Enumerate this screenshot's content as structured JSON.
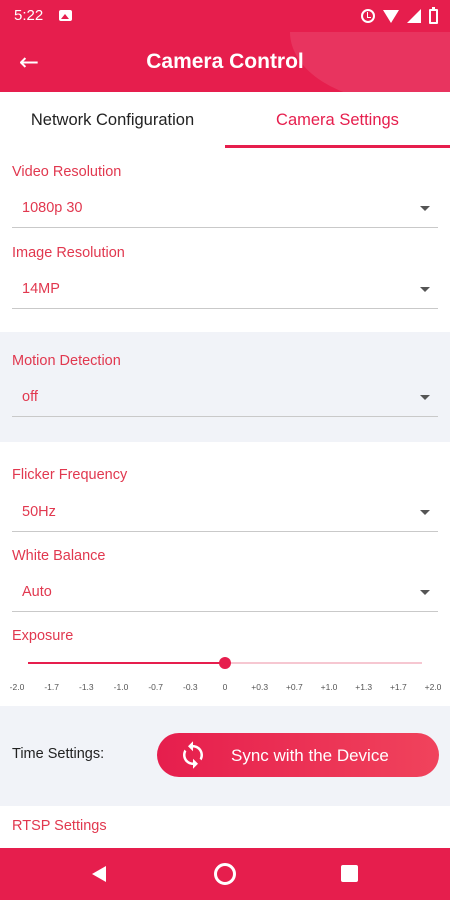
{
  "status_bar": {
    "time": "5:22",
    "icons": [
      "image-icon",
      "alarm-icon",
      "wifi-icon",
      "signal-icon",
      "battery-icon"
    ]
  },
  "app_bar": {
    "title": "Camera Control",
    "back_icon": "arrow-back-icon",
    "color": "#e61e4d"
  },
  "tabs": [
    {
      "label": "Network Configuration",
      "active": false
    },
    {
      "label": "Camera Settings",
      "active": true
    }
  ],
  "settings": {
    "video_resolution": {
      "label": "Video Resolution",
      "value": "1080p 30"
    },
    "image_resolution": {
      "label": "Image Resolution",
      "value": "14MP"
    },
    "motion_detection": {
      "label": "Motion Detection",
      "value": "off"
    },
    "flicker_frequency": {
      "label": "Flicker Frequency",
      "value": "50Hz"
    },
    "white_balance": {
      "label": "White Balance",
      "value": "Auto"
    },
    "exposure": {
      "label": "Exposure",
      "value": "0",
      "ticks": [
        "-2.0",
        "-1.7",
        "-1.3",
        "-1.0",
        "-0.7",
        "-0.3",
        "0",
        "+0.3",
        "+0.7",
        "+1.0",
        "+1.3",
        "+1.7",
        "+2.0"
      ]
    },
    "time_settings": {
      "label": "Time Settings:",
      "button_label": "Sync with the Device",
      "button_icon": "sync-icon"
    },
    "rtsp": {
      "label": "RTSP Settings"
    }
  },
  "nav_bar": {
    "icons": [
      "nav-back-icon",
      "nav-home-icon",
      "nav-recent-icon"
    ]
  },
  "colors": {
    "accent": "#e61e4d",
    "label": "#e1384f",
    "section_gray": "#f1f3f8"
  }
}
